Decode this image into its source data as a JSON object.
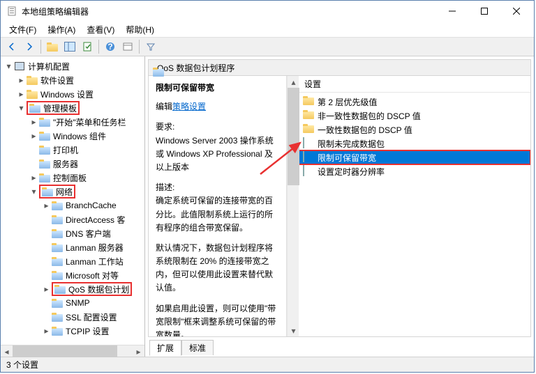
{
  "window": {
    "title": "本地组策略编辑器"
  },
  "menu": {
    "file": "文件(F)",
    "action": "操作(A)",
    "view": "查看(V)",
    "help": "帮助(H)"
  },
  "tree": {
    "root": "计算机配置",
    "n1": "软件设置",
    "n2": "Windows 设置",
    "n3": "管理模板",
    "n3a": "\"开始\"菜单和任务栏",
    "n3b": "Windows 组件",
    "n3c": "打印机",
    "n3d": "服务器",
    "n3e": "控制面板",
    "n3f": "网络",
    "n3f1": "BranchCache",
    "n3f2": "DirectAccess 客",
    "n3f3": "DNS 客户端",
    "n3f4": "Lanman 服务器",
    "n3f5": "Lanman 工作站",
    "n3f6": "Microsoft 对等",
    "n3f7": "QoS 数据包计划",
    "n3f8": "SNMP",
    "n3f9": "SSL 配置设置",
    "n3f10": "TCPIP 设置"
  },
  "path": {
    "label": "QoS 数据包计划程序"
  },
  "detail": {
    "title": "限制可保留带宽",
    "editlink_pre": "编辑",
    "editlink": "策略设置",
    "req_label": "要求:",
    "req_text": "Windows Server 2003 操作系统或 Windows XP Professional 及以上版本",
    "desc_label": "描述:",
    "desc1": "确定系统可保留的连接带宽的百分比。此值限制系统上运行的所有程序的组合带宽保留。",
    "desc2": "默认情况下，数据包计划程序将系统限制在 20% 的连接带宽之内，但可以使用此设置来替代默认值。",
    "desc3": "如果启用此设置，则可以使用\"带宽限制\"框来调整系统可保留的带宽数量。"
  },
  "settings": {
    "header": "设置",
    "items": [
      {
        "icon": "folder",
        "label": "第 2 层优先级值"
      },
      {
        "icon": "folder",
        "label": "非一致性数据包的 DSCP 值"
      },
      {
        "icon": "folder",
        "label": "一致性数据包的 DSCP 值"
      },
      {
        "icon": "doc",
        "label": "限制未完成数据包"
      },
      {
        "icon": "doc",
        "label": "限制可保留带宽"
      },
      {
        "icon": "doc",
        "label": "设置定时器分辨率"
      }
    ]
  },
  "tabs": {
    "extended": "扩展",
    "standard": "标准"
  },
  "status": "3 个设置"
}
